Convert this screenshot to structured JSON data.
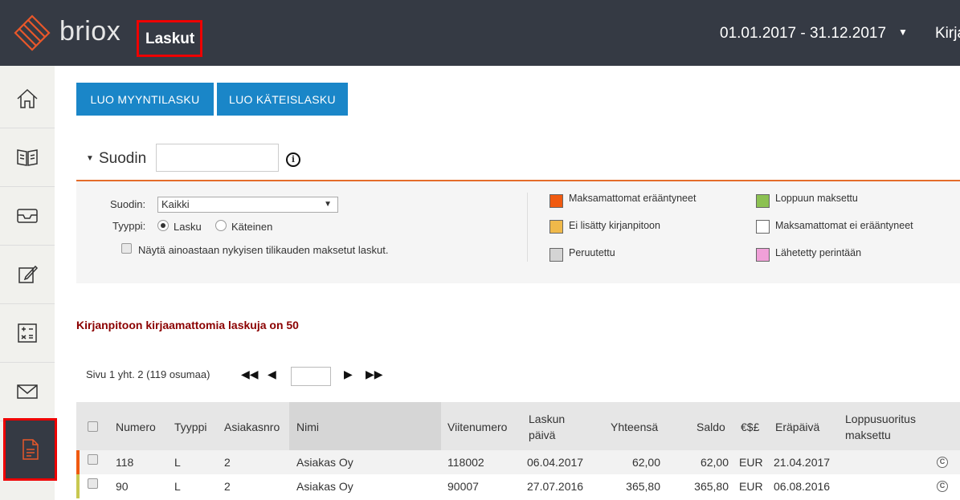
{
  "header": {
    "brand": "briox",
    "page_title": "Laskut",
    "period": "01.01.2017 - 31.12.2017",
    "user_cut": "Kirja"
  },
  "sidebar": {
    "items": [
      {
        "icon": "home-icon"
      },
      {
        "icon": "book-icon"
      },
      {
        "icon": "inbox-icon"
      },
      {
        "icon": "edit-icon"
      },
      {
        "icon": "calculator-icon"
      },
      {
        "icon": "mail-icon"
      },
      {
        "icon": "invoice-document-icon",
        "active": true
      }
    ]
  },
  "buttons": {
    "create_sales_invoice": "LUO MYYNTILASKU",
    "create_cash_invoice": "LUO KÄTEISLASKU"
  },
  "filter": {
    "title": "Suodin",
    "panel": {
      "filter_label": "Suodin:",
      "filter_value": "Kaikki",
      "type_label": "Tyyppi:",
      "type_options": [
        "Lasku",
        "Käteinen"
      ],
      "type_selected": "Lasku",
      "only_current_period_label": "Näytä ainoastaan nykyisen tilikauden maksetut laskut."
    },
    "legend": [
      {
        "label": "Maksamattomat erääntyneet",
        "color": "#f05a10"
      },
      {
        "label": "Loppuun maksettu",
        "color": "#8cc152"
      },
      {
        "label": "Ei lisätty kirjanpitoon",
        "color": "#f0b94a"
      },
      {
        "label": "Maksamattomat ei erääntyneet",
        "color": "#ffffff"
      },
      {
        "label": "Peruutettu",
        "color": "#d4d4d4"
      },
      {
        "label": "Lähetetty perintään",
        "color": "#f0a0d8"
      }
    ]
  },
  "notice": "Kirjanpitoon kirjaamattomia laskuja on 50",
  "pager": {
    "text": "Sivu 1 yht. 2  (119 osumaa)",
    "page_value": ""
  },
  "table": {
    "headers": {
      "numero": "Numero",
      "tyyppi": "Tyyppi",
      "asiakasnro": "Asiakasnro",
      "nimi": "Nimi",
      "viitenumero": "Viitenumero",
      "laskun_paiva_1": "Laskun",
      "laskun_paiva_2": "päivä",
      "yhteensa": "Yhteensä",
      "saldo": "Saldo",
      "valuutta": "€$£",
      "erapaiva": "Eräpäivä",
      "loppusuoritus_1": "Loppusuoritus",
      "loppusuoritus_2": "maksettu"
    },
    "rows": [
      {
        "numero": "118",
        "tyyppi": "L",
        "asiakasnro": "2",
        "nimi": "Asiakas Oy",
        "viitenumero": "118002",
        "laskun_paiva": "06.04.2017",
        "yhteensa": "62,00",
        "saldo": "62,00",
        "valuutta": "EUR",
        "erapaiva": "21.04.2017",
        "status_color": "#f05a10"
      },
      {
        "numero": "90",
        "tyyppi": "L",
        "asiakasnro": "2",
        "nimi": "Asiakas Oy",
        "viitenumero": "90007",
        "laskun_paiva": "27.07.2016",
        "yhteensa": "365,80",
        "saldo": "365,80",
        "valuutta": "EUR",
        "erapaiva": "06.08.2016",
        "status_color": "#c8c850"
      }
    ]
  }
}
